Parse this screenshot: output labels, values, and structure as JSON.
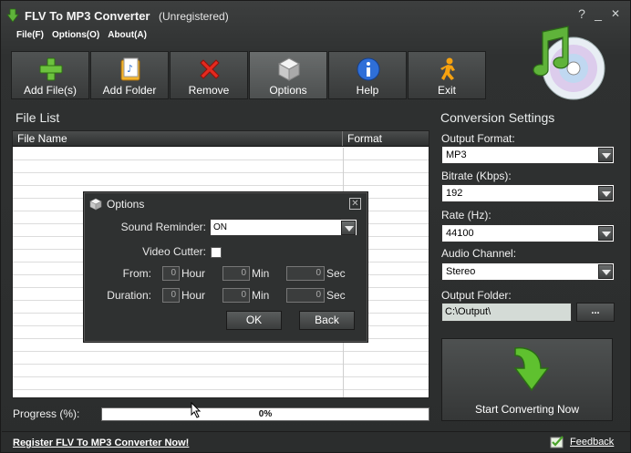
{
  "window": {
    "title": "FLV To MP3 Converter",
    "subtitle": "(Unregistered)",
    "help_glyph": "?",
    "minimize_glyph": "_",
    "close_glyph": "✕"
  },
  "menu": {
    "items": [
      "File(F)",
      "Options(O)",
      "About(A)"
    ]
  },
  "toolbar": {
    "buttons": [
      {
        "label": "Add File(s)",
        "icon": "plus-icon"
      },
      {
        "label": "Add Folder",
        "icon": "folder-icon"
      },
      {
        "label": "Remove",
        "icon": "remove-x-icon"
      },
      {
        "label": "Options",
        "icon": "cube-icon"
      },
      {
        "label": "Help",
        "icon": "info-icon"
      },
      {
        "label": "Exit",
        "icon": "exit-man-icon"
      }
    ],
    "active": "Options"
  },
  "file_list": {
    "title": "File List",
    "columns": [
      "File Name",
      "Format"
    ],
    "rows": []
  },
  "progress": {
    "label": "Progress (%):",
    "value": 0,
    "text": "0%"
  },
  "footer": {
    "register_link": "Register FLV To MP3 Converter Now!",
    "feedback": "Feedback"
  },
  "conversion": {
    "title": "Conversion Settings",
    "output_format_label": "Output Format:",
    "output_format": "MP3",
    "bitrate_label": "Bitrate (Kbps):",
    "bitrate": "192",
    "rate_label": "Rate (Hz):",
    "rate": "44100",
    "channel_label": "Audio Channel:",
    "channel": "Stereo",
    "folder_label": "Output Folder:",
    "folder": "C:\\Output\\",
    "browse_label": "...",
    "start_label": "Start Converting Now"
  },
  "options_dialog": {
    "title": "Options",
    "close_glyph": "✕",
    "sound_reminder_label": "Sound Reminder:",
    "sound_reminder": "ON",
    "video_cutter_label": "Video Cutter:",
    "from_label": "From:",
    "duration_label": "Duration:",
    "from": {
      "hour": "0",
      "min": "0",
      "sec": "0"
    },
    "duration": {
      "hour": "0",
      "min": "0",
      "sec": "0"
    },
    "hour_unit": "Hour",
    "min_unit": "Min",
    "sec_unit": "Sec",
    "ok_label": "OK",
    "back_label": "Back"
  },
  "colors": {
    "background": "#2b2d2d",
    "accent_green": "#5fa83a",
    "text": "#ffffff"
  }
}
